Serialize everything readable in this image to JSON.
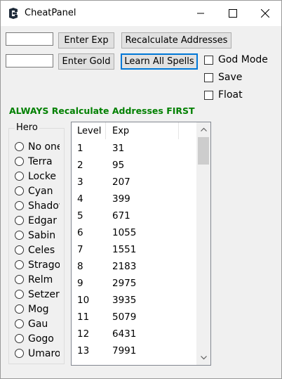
{
  "window": {
    "title": "CheatPanel"
  },
  "icons": {
    "app": "cheat-engine-icon",
    "minimize": "minimize-icon",
    "maximize": "maximize-icon",
    "close": "close-icon"
  },
  "inputs": {
    "exp_value": "",
    "gold_value": ""
  },
  "buttons": {
    "enter_exp": "Enter Exp",
    "recalculate": "Recalculate Addresses",
    "enter_gold": "Enter Gold",
    "learn_spells": "Learn All Spells"
  },
  "checkboxes": [
    {
      "label": "God Mode",
      "checked": false
    },
    {
      "label": "Save",
      "checked": false
    },
    {
      "label": "Float",
      "checked": false
    }
  ],
  "warning": {
    "text": "ALWAYS Recalculate Addresses FIRST",
    "color": "#008000"
  },
  "hero_group": {
    "title": "Hero",
    "options": [
      "No one",
      "Terra",
      "Locke",
      "Cyan",
      "Shadow",
      "Edgar",
      "Sabin",
      "Celes",
      "Strago",
      "Relm",
      "Setzer",
      "Mog",
      "Gau",
      "Gogo",
      "Umaro"
    ]
  },
  "exp_table": {
    "columns": [
      "Level",
      "Exp"
    ],
    "rows": [
      [
        "1",
        "31"
      ],
      [
        "2",
        "95"
      ],
      [
        "3",
        "207"
      ],
      [
        "4",
        "399"
      ],
      [
        "5",
        "671"
      ],
      [
        "6",
        "1055"
      ],
      [
        "7",
        "1551"
      ],
      [
        "8",
        "2183"
      ],
      [
        "9",
        "2975"
      ],
      [
        "10",
        "3935"
      ],
      [
        "11",
        "5079"
      ],
      [
        "12",
        "6431"
      ],
      [
        "13",
        "7991"
      ]
    ]
  },
  "colors": {
    "focus_border": "#0078d7",
    "button_bg": "#e1e1e1"
  }
}
